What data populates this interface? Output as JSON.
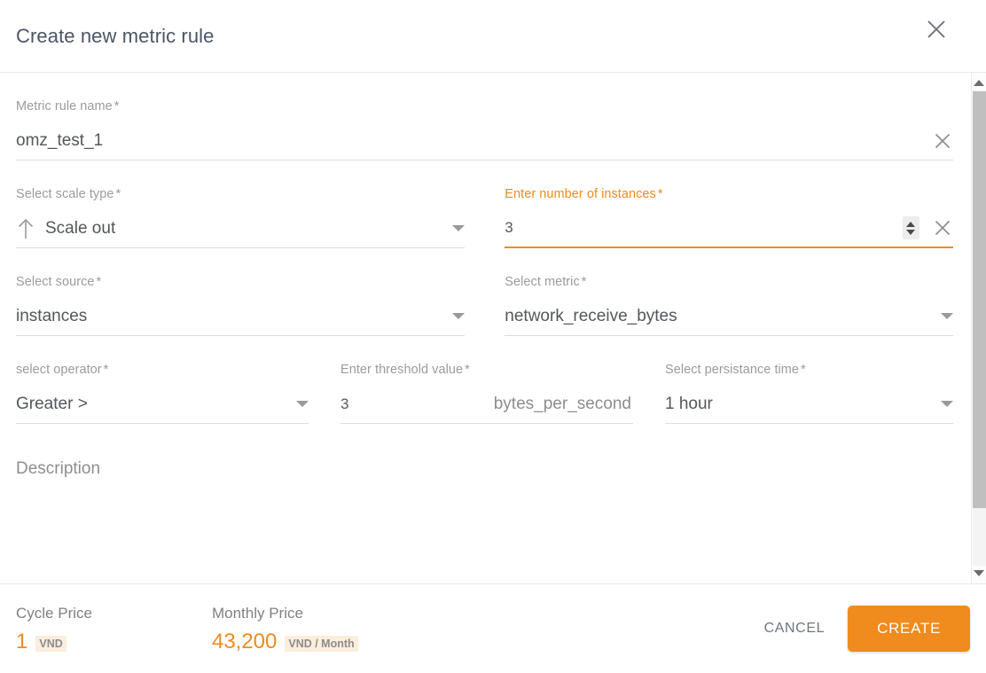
{
  "dialog": {
    "title": "Create new metric rule",
    "close_icon": "close-icon"
  },
  "form": {
    "metric_rule_name": {
      "label": "Metric rule name",
      "required": "*",
      "value": "omz_test_1",
      "placeholder": "",
      "clear_icon": "close-icon"
    },
    "scale_type": {
      "label": "Select scale type",
      "required": "*",
      "value": "Scale out",
      "icon": "arrow-up-icon",
      "caret_icon": "chevron-down-icon"
    },
    "instances": {
      "label": "Enter number of instances",
      "required": "*",
      "value": "3",
      "active": true,
      "stepper_icon": "number-stepper-icon",
      "clear_icon": "close-icon"
    },
    "source": {
      "label": "Select source",
      "required": "*",
      "value": "instances",
      "caret_icon": "chevron-down-icon"
    },
    "metric": {
      "label": "Select metric",
      "required": "*",
      "value": "network_receive_bytes",
      "caret_icon": "chevron-down-icon"
    },
    "operator": {
      "label": "select operator",
      "required": "*",
      "value": "Greater >",
      "caret_icon": "chevron-down-icon"
    },
    "threshold": {
      "label": "Enter threshold value",
      "required": "*",
      "value": "3",
      "unit": "bytes_per_second"
    },
    "persistance_time": {
      "label": "Select persistance time",
      "required": "*",
      "value": "1 hour",
      "caret_icon": "chevron-down-icon"
    },
    "description": {
      "label": "Description"
    }
  },
  "footer": {
    "cycle_price": {
      "title": "Cycle Price",
      "amount": "1",
      "unit": "VND"
    },
    "monthly_price": {
      "title": "Monthly Price",
      "amount": "43,200",
      "unit": "VND / Month"
    },
    "cancel_label": "CANCEL",
    "create_label": "CREATE"
  },
  "colors": {
    "accent": "#f08b1d",
    "title": "#4c5566",
    "label": "#9b9b9b",
    "value": "#53575c",
    "unit_badge_bg": "#fbeedc"
  },
  "scrollbar": {
    "up_icon": "scroll-up-arrow-icon",
    "down_icon": "scroll-down-arrow-icon"
  }
}
